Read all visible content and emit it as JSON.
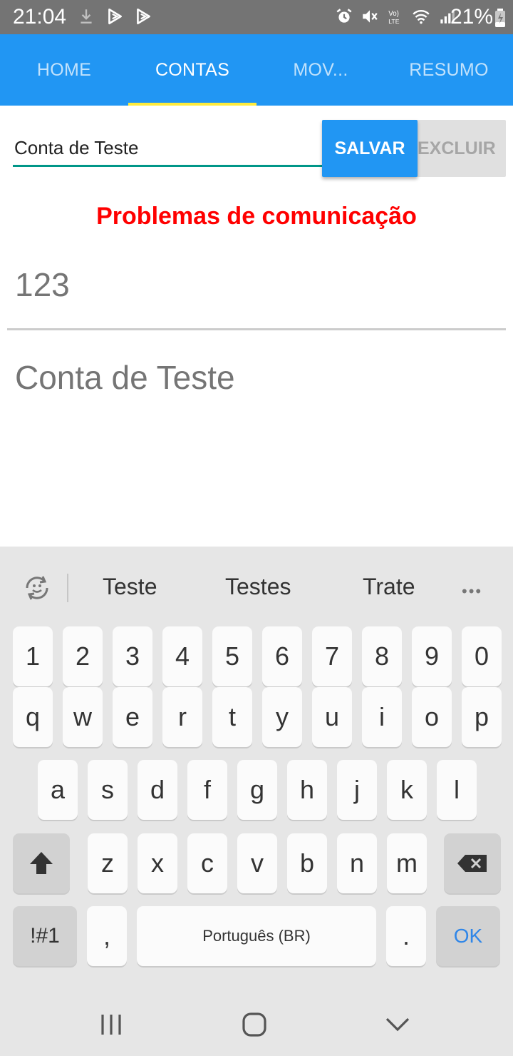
{
  "status_bar": {
    "time": "21:04",
    "battery": "21%",
    "left_icons": [
      "download-icon",
      "play-store-icon",
      "play-store-icon"
    ],
    "right_icons": [
      "alarm-icon",
      "mute-icon",
      "volte-icon",
      "wifi-icon",
      "signal-icon"
    ]
  },
  "tabs": [
    {
      "label": "HOME",
      "active": false
    },
    {
      "label": "CONTAS",
      "active": true
    },
    {
      "label": "MOV...",
      "active": false
    },
    {
      "label": "RESUMO",
      "active": false
    }
  ],
  "form": {
    "account_name_value": "Conta de Teste",
    "save_label": "SALVAR",
    "delete_label": "EXCLUIR",
    "error_message": "Problemas de comunicação",
    "code_value": "123",
    "name_display": "Conta de Teste"
  },
  "keyboard": {
    "suggestions": [
      "Teste",
      "Testes",
      "Trate"
    ],
    "more_label": "•••",
    "row_numbers": [
      "1",
      "2",
      "3",
      "4",
      "5",
      "6",
      "7",
      "8",
      "9",
      "0"
    ],
    "row_top": [
      "q",
      "w",
      "e",
      "r",
      "t",
      "y",
      "u",
      "i",
      "o",
      "p"
    ],
    "row_middle": [
      "a",
      "s",
      "d",
      "f",
      "g",
      "h",
      "j",
      "k",
      "l"
    ],
    "row_bottom": [
      "z",
      "x",
      "c",
      "v",
      "b",
      "n",
      "m"
    ],
    "symbols_label": "!#1",
    "comma_label": ",",
    "space_label": "Português (BR)",
    "period_label": ".",
    "enter_label": "OK"
  },
  "colors": {
    "primary": "#2196f3",
    "tab_indicator": "#ffeb3b",
    "input_underline": "#009688",
    "error": "#ff0000",
    "status_bar": "#747474",
    "keyboard_bg": "#e6e6e6",
    "ok_key": "#2f86e8"
  }
}
